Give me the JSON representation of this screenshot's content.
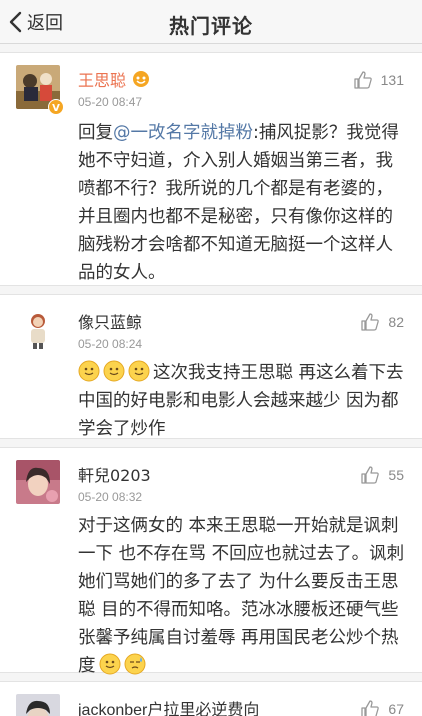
{
  "header": {
    "back_label": "返回",
    "title": "热门评论"
  },
  "comments": [
    {
      "name": "王思聪",
      "time": "05-20 08:47",
      "likes": "131",
      "reply_prefix": "回复",
      "mention": "@一改名字就掉粉",
      "text": ":捕风捉影？我觉得她不守妇道，介入别人婚姻当第三者，我喷都不行？我所说的几个都是有老婆的，并且圈内也都不是秘密，只有像你这样的脑残粉才会啥都不知道无脑挺一个这样人品的女人。"
    },
    {
      "name": "像只蓝鲸",
      "time": "05-20 08:24",
      "likes": "82",
      "text": "这次我支持王思聪 再这么着下去 中国的好电影和电影人会越来越少 因为都学会了炒作"
    },
    {
      "name": "軒兒0203",
      "time": "05-20 08:32",
      "likes": "55",
      "text": "对于这俩女的 本来王思聪一开始就是讽刺一下 也不存在骂 不回应也就过去了。讽刺她们骂她们的多了去了 为什么要反击王思聪 目的不得而知咯。范冰冰腰板还硬气些 张馨予纯属自讨羞辱 再用国民老公炒个热度"
    },
    {
      "name": "jackonber户拉里必逆费向",
      "likes": "67"
    }
  ],
  "colors": {
    "accent_orange": "#eb7350",
    "link_blue": "#5478a6"
  },
  "icons": {
    "back": "chevron-left-icon",
    "like": "thumbs-up-icon",
    "vip": "vip-badge-icon",
    "emoji": "smile-emoji-icon"
  }
}
